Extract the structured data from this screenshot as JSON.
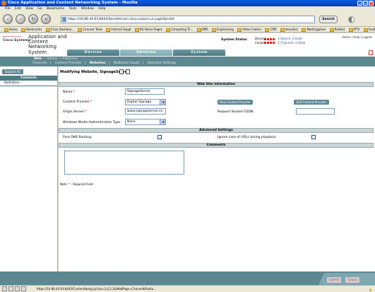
{
  "window": {
    "title": "Cisco Application and Content Networking System - Mozilla"
  },
  "menubar": {
    "items": [
      "File",
      "Edit",
      "View",
      "Go",
      "Bookmarks",
      "Tools",
      "Window",
      "Help"
    ]
  },
  "navbar": {
    "url": "https://10.86.44.63:8443/Servlet/com.cisco.unicorn.ui.LoginServlet",
    "search_label": "Search"
  },
  "bookmarks": [
    "Home",
    "Bookmarks",
    "Cisco Dashboa...",
    "Connect Tools",
    "Internal Suppt",
    "BU Home Pages",
    "Competing Te...",
    "DMS",
    "Engineering",
    "Video Codecs",
    "CRM",
    "decoders",
    "Meetingplace",
    "RedHat",
    "IPTV",
    "Football"
  ],
  "app": {
    "logo": "Cisco Systems",
    "title": "Application and Content Networking System",
    "tabs": [
      "Devices",
      "Services",
      "System"
    ],
    "active_tab": "Services",
    "status_title": "System Status",
    "status_rows": [
      {
        "label": "Devices",
        "value": "1 Device, Critical"
      },
      {
        "label": "Content",
        "value": "1 Channels, Critical"
      }
    ],
    "top_links": "Home | Help | Logout"
  },
  "subnav": {
    "path": [
      "Web",
      "Videos",
      "Platforms"
    ],
    "items": [
      "Channels",
      "Content Provider",
      "Websites",
      "Multicast Clouds",
      "Selective Settings"
    ],
    "active": "Websites"
  },
  "sidebar": {
    "expand_label": "Expand All",
    "contents_label": "Contents",
    "items": [
      "Definition"
    ]
  },
  "form": {
    "page_title": "Modifying Website, SignageServer",
    "section_info": "Web Site Information",
    "name_label": "Name:",
    "name_value": "SignageServer",
    "provider_label": "Content Provider:",
    "provider_value": "Digital Signage",
    "new_provider_btn": "New Content Provider",
    "edit_provider_btn": "Edit Content Provider",
    "origin_label": "Origin Server:",
    "origin_value": "www.signageserver.co",
    "fqdn_label": "Request Routed FQDN:",
    "fqdn_value": "",
    "wma_label": "Windows Media Authentication Type:",
    "wma_value": "None",
    "section_advanced": "Advanced Settings",
    "pure_dns_label": "Pure DNS Routing:",
    "ignore_case_label": "Ignore case of URLs during playback:",
    "section_comments": "Comments",
    "note_prefix": "Note:",
    "note_text": " - Required Field"
  },
  "buttons": {
    "submit": "Submit",
    "cancel": "Cancel"
  },
  "statusbar": {
    "text": "https://10.86.44.63:8443/Content/body.jsp?pa=2,0,2,1&WebPage=Channel&Radio..."
  }
}
